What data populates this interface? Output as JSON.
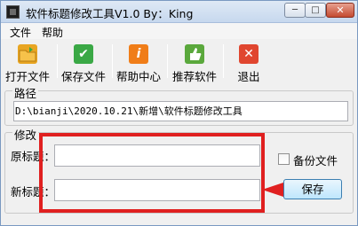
{
  "window": {
    "title": "软件标题修改工具V1.0 By：King",
    "controls": {
      "minimize": "─",
      "maximize": "□",
      "close": "✕"
    }
  },
  "menu": {
    "items": [
      {
        "label": "文件"
      },
      {
        "label": "帮助"
      }
    ]
  },
  "toolbar": {
    "buttons": [
      {
        "label": "打开文件",
        "icon": "folder-icon",
        "color": "#e8a521"
      },
      {
        "label": "保存文件",
        "icon": "checkmark-icon",
        "color": "#3aa845"
      },
      {
        "label": "帮助中心",
        "icon": "info-icon",
        "color": "#f07d18"
      },
      {
        "label": "推荐软件",
        "icon": "thumbs-up-icon",
        "color": "#5aa83c"
      },
      {
        "label": "退出",
        "icon": "close-icon",
        "color": "#e0462f"
      }
    ]
  },
  "path_group": {
    "label": "路径",
    "value": "D:\\bianji\\2020.10.21\\新增\\软件标题修改工具"
  },
  "edit_group": {
    "label": "修改",
    "original_label": "原标题：",
    "original_value": "",
    "new_label": "新标题：",
    "new_value": "",
    "backup_label": "备份文件",
    "backup_checked": false,
    "save_label": "保存"
  },
  "colors": {
    "highlight": "#e02020",
    "accent": "#3c7fb1"
  }
}
